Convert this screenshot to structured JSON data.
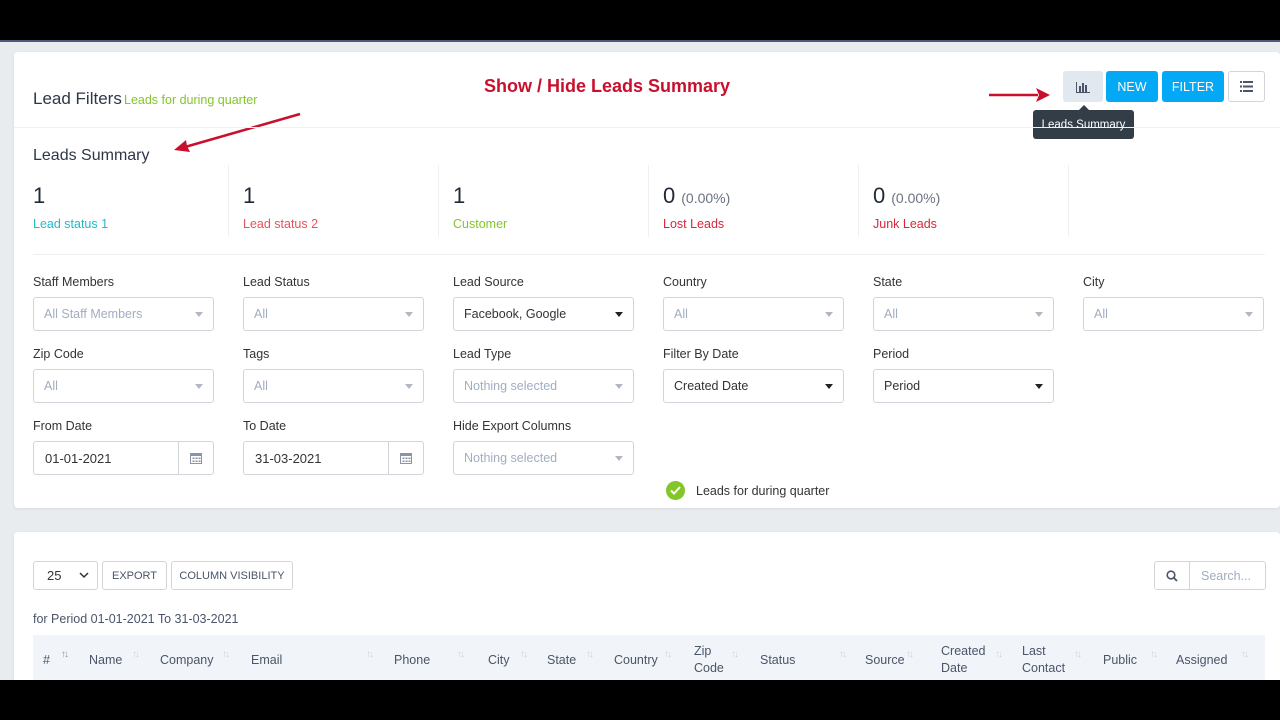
{
  "annotation": "Show / Hide Leads Summary",
  "header": {
    "title": "Lead Filters",
    "subtitle": "Leads for during quarter",
    "new_label": "NEW",
    "filter_label": "FILTER",
    "tooltip": "Leads Summary"
  },
  "summary": {
    "title": "Leads Summary",
    "stats": [
      {
        "value": "1",
        "pct": "",
        "label": "Lead status 1",
        "color": "#22b8cf"
      },
      {
        "value": "1",
        "pct": "",
        "label": "Lead status 2",
        "color": "#e2545b"
      },
      {
        "value": "1",
        "pct": "",
        "label": "Customer",
        "color": "#84c529"
      },
      {
        "value": "0",
        "pct": "(0.00%)",
        "label": "Lost Leads",
        "color": "#d9263a"
      },
      {
        "value": "0",
        "pct": "(0.00%)",
        "label": "Junk Leads",
        "color": "#d9263a"
      }
    ]
  },
  "filters": {
    "staff": {
      "label": "Staff Members",
      "value": "All Staff Members"
    },
    "status": {
      "label": "Lead Status",
      "value": "All"
    },
    "source": {
      "label": "Lead Source",
      "value": "Facebook, Google"
    },
    "country": {
      "label": "Country",
      "value": "All"
    },
    "state": {
      "label": "State",
      "value": "All"
    },
    "city": {
      "label": "City",
      "value": "All"
    },
    "zip": {
      "label": "Zip Code",
      "value": "All"
    },
    "tags": {
      "label": "Tags",
      "value": "All"
    },
    "type": {
      "label": "Lead Type",
      "value": "Nothing selected"
    },
    "filter_by_date": {
      "label": "Filter By Date",
      "value": "Created Date"
    },
    "period": {
      "label": "Period",
      "value": "Period"
    },
    "from_date": {
      "label": "From Date",
      "value": "01-01-2021"
    },
    "to_date": {
      "label": "To Date",
      "value": "31-03-2021"
    },
    "hide_export": {
      "label": "Hide Export Columns",
      "value": "Nothing selected"
    },
    "quarter_check": "Leads for during quarter"
  },
  "table": {
    "page_size": "25",
    "export_label": "EXPORT",
    "column_visibility_label": "COLUMN VISIBILITY",
    "search_placeholder": "Search...",
    "period_text": "for Period 01-01-2021 To 31-03-2021",
    "columns": [
      "#",
      "Name",
      "Company",
      "Email",
      "Phone",
      "City",
      "State",
      "Country",
      "Zip Code",
      "Status",
      "Source",
      "Created Date",
      "Last Contact",
      "Public",
      "Assigned"
    ]
  },
  "colors": {
    "accent": "#03a9f4",
    "success": "#84c529",
    "annotation": "#c8102e"
  }
}
